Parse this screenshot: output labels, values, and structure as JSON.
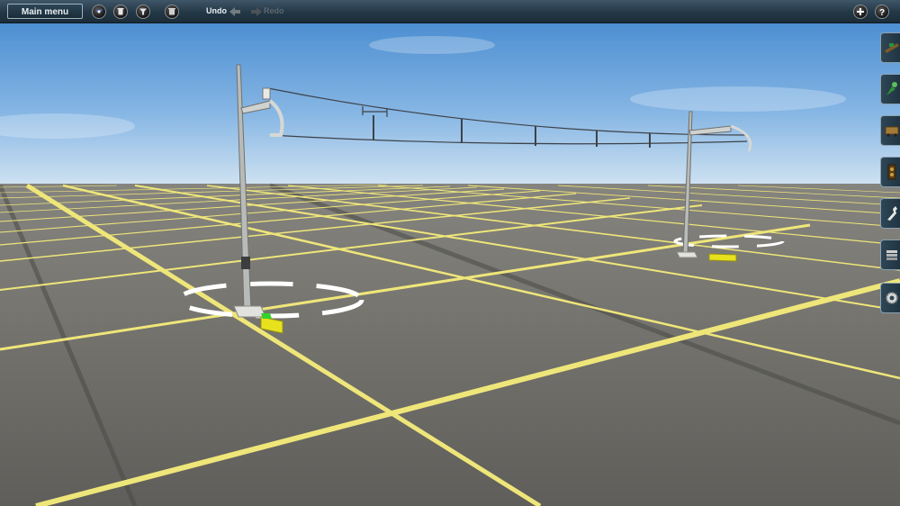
{
  "toolbar": {
    "main_menu_label": "Main menu",
    "undo_label": "Undo",
    "redo_label": "Redo",
    "left_icons": [
      "compass-icon",
      "trash-icon",
      "filter-icon",
      "delete-icon"
    ],
    "right_icons": [
      "add-icon",
      "help-icon"
    ]
  },
  "side_tabs": [
    "track-tool-icon",
    "objects-tool-icon",
    "rolling-stock-icon",
    "signals-tool-icon",
    "wrench-icon",
    "layers-icon",
    "settings-gear-icon"
  ],
  "colors": {
    "sky_top": "#4f90d3",
    "sky_bottom": "#c8dff0",
    "ground": "#6d6c68",
    "grid_line": "#f0e878",
    "toolbar": "#243846"
  }
}
